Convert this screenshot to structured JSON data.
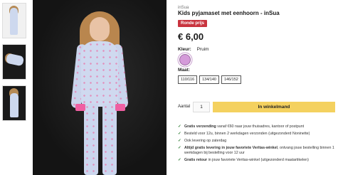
{
  "product": {
    "brand": "inSua",
    "title": "Kids pyjamaset met eenhoorn - inSua",
    "badge": "Ronde prijs",
    "price": "€ 6,00",
    "color_label": "Kleur:",
    "color_value": "Pruim",
    "color_swatch": "#d49ad9",
    "size_label": "Maat:",
    "sizes": [
      "110/116",
      "134/140",
      "146/152"
    ]
  },
  "cart": {
    "qty_label": "Aantal",
    "qty_value": "1",
    "button_label": "In winkelmand",
    "button_color": "#f4d15f"
  },
  "usps": [
    {
      "bold": "Gratis verzending",
      "text": " vanaf €60 naar jouw thuisadres, kantoor of postpunt"
    },
    {
      "bold": "",
      "text": "Besteld voor 12u, binnen 2 werkdagen verzonden (uitgezonderd Noninette)"
    },
    {
      "bold": "",
      "text": "Ook levering op zaterdag"
    },
    {
      "bold": "Altijd gratis levering in jouw favoriete Veritas-winkel",
      "text": ", ontvang jouw bestelling binnen 1"
    },
    {
      "bold": "",
      "text": "werkdagen bij bestelling voor 12 uur"
    },
    {
      "bold": "Gratis retour",
      "text": " in jouw favoriete Veritas-winkel (uitgezonderd maatartikelen)"
    }
  ],
  "icons": {
    "check": "check-icon"
  }
}
